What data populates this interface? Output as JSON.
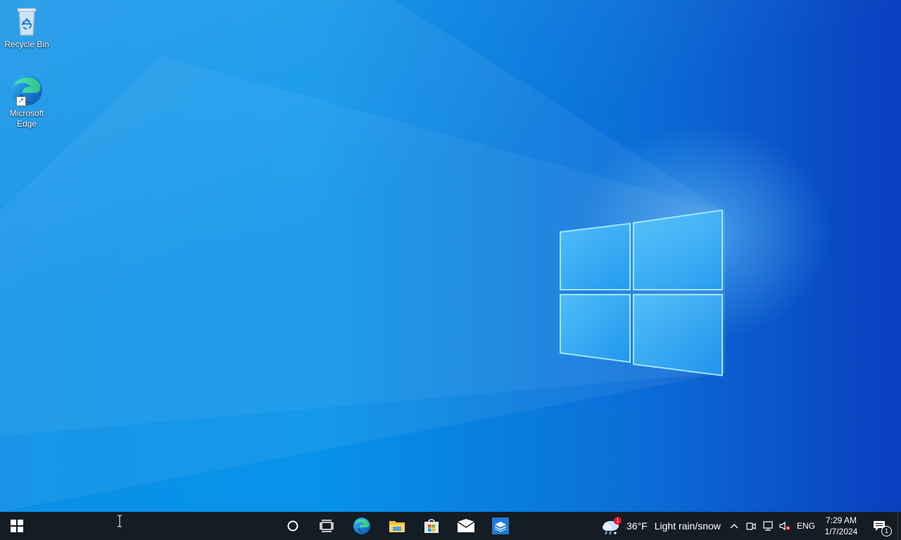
{
  "desktop": {
    "icons": [
      {
        "label": "Recycle Bin",
        "icon": "recycle-bin-icon"
      },
      {
        "label": "Microsoft Edge",
        "icon": "edge-icon"
      }
    ]
  },
  "taskbar": {
    "start": {
      "icon": "windows-logo-icon"
    },
    "search": {
      "icon": "cortana-circle-icon"
    },
    "task_view": {
      "icon": "task-view-icon"
    },
    "pinned_apps": [
      {
        "name": "Microsoft Edge",
        "icon": "edge-icon"
      },
      {
        "name": "File Explorer",
        "icon": "folder-icon"
      },
      {
        "name": "Microsoft Store",
        "icon": "store-bag-icon"
      },
      {
        "name": "Mail",
        "icon": "mail-icon"
      },
      {
        "name": "Sandbox app",
        "icon": "layered-box-icon"
      }
    ],
    "weather": {
      "temp": "36°F",
      "condition": "Light rain/snow",
      "alert_count": "1"
    },
    "tray": {
      "icons": [
        "chevron-up-icon",
        "meet-now-icon",
        "network-icon",
        "volume-muted-icon"
      ],
      "language": "ENG",
      "time": "7:29 AM",
      "date": "1/7/2024",
      "notification_count": "1"
    }
  },
  "colors": {
    "taskbar": "#141c24",
    "wallpaper_light": "#0a8fe6",
    "wallpaper_dark": "#0a3fbf",
    "badge": "#e81123"
  }
}
